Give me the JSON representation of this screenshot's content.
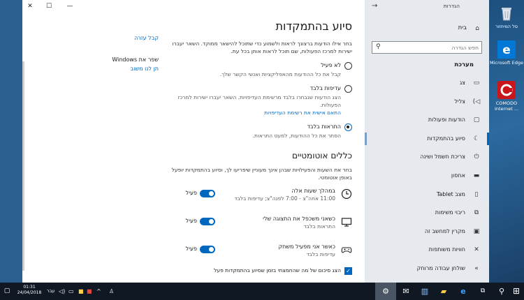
{
  "window": {
    "minimize": "—",
    "maximize": "☐",
    "close": "✕"
  },
  "help": {
    "get_help": "קבל עזרה",
    "improve_title": "שפר את Windows",
    "feedback": "תן לנו משוב"
  },
  "page": {
    "title": "סיוע בהתמקדות",
    "description": "בחר אילו הודעות ברצונך לראות ולשמוע כדי שתוכל להישאר ממוקד. השאר יעברו ישירות למרכז הפעולות, שם תוכל לראות אותן בכל עת.",
    "options": [
      {
        "label": "לא פעיל",
        "desc": "קבל את כל ההודעות מהאפליקציות ואנשי הקשר שלך.",
        "selected": false
      },
      {
        "label": "עדיפות בלבד",
        "desc": "הצג הודעות שנבחרו בלבד מרשימת העדיפויות. השאר יעברו ישירות למרכז הפעולות.",
        "link": "התאם אישית את רשימת העדיפויות",
        "selected": false
      },
      {
        "label": "התראות בלבד",
        "desc": "הסתר את כל ההודעות, למעט התראות.",
        "selected": true
      }
    ],
    "rules_title": "כללים אוטומטיים",
    "rules_desc": "בחר את השעות והפעילויות שבהן אינך מעוניין שיפריעו לך, וסיוע בהתמקדות יופעל באופן אוטומטי.",
    "rules": [
      {
        "title": "במהלך שעות אלה",
        "sub": "11:00 אחה\"צ - 7:00 לפנה\"צ; עדיפות בלבד",
        "state": "פעיל",
        "icon": "clock-icon"
      },
      {
        "title": "כשאני משכפל את התצוגה שלי",
        "sub": "התראות בלבד",
        "state": "פעיל",
        "icon": "monitor-icon"
      },
      {
        "title": "כאשר אני מפעיל משחק",
        "sub": "עדיפות בלבד",
        "state": "פעיל",
        "icon": "gamepad-icon"
      }
    ],
    "summary_checkbox": "הצג סיכום של מה שהחמצתי בזמן שסיוע בהתמקדות פעל"
  },
  "sidebar": {
    "title": "הגדרות",
    "home": "בית",
    "search_placeholder": "חפש הגדרה",
    "heading": "מערכת",
    "items": [
      {
        "label": "צג",
        "icon": "display-icon"
      },
      {
        "label": "צליל",
        "icon": "speaker-icon"
      },
      {
        "label": "הודעות ופעולות",
        "icon": "notifications-icon"
      },
      {
        "label": "סיוע בהתמקדות",
        "icon": "moon-icon",
        "active": true
      },
      {
        "label": "צריכת חשמל ושינה",
        "icon": "power-icon"
      },
      {
        "label": "אחסון",
        "icon": "storage-icon"
      },
      {
        "label": "מצב Tablet",
        "icon": "tablet-icon"
      },
      {
        "label": "ריבוי משימות",
        "icon": "multitask-icon"
      },
      {
        "label": "מקרין למחשב זה",
        "icon": "project-icon"
      },
      {
        "label": "חוויות משותפות",
        "icon": "shared-icon"
      },
      {
        "label": "שולחן עבודה מרוחק",
        "icon": "remote-icon"
      }
    ]
  },
  "desktop": {
    "icons": [
      {
        "label": "סל המיחזור",
        "icon": "recycle-bin-icon"
      },
      {
        "label": "Microsoft Edge",
        "icon": "edge-icon"
      },
      {
        "label": "COMODO Internet ...",
        "icon": "comodo-icon"
      }
    ]
  },
  "taskbar": {
    "time": "01:31",
    "date": "24/04/2018",
    "lang": "עבר"
  },
  "colors": {
    "accent": "#0067c0",
    "sidebar_bg": "#e6e9ee",
    "taskbar_bg": "#101923"
  }
}
